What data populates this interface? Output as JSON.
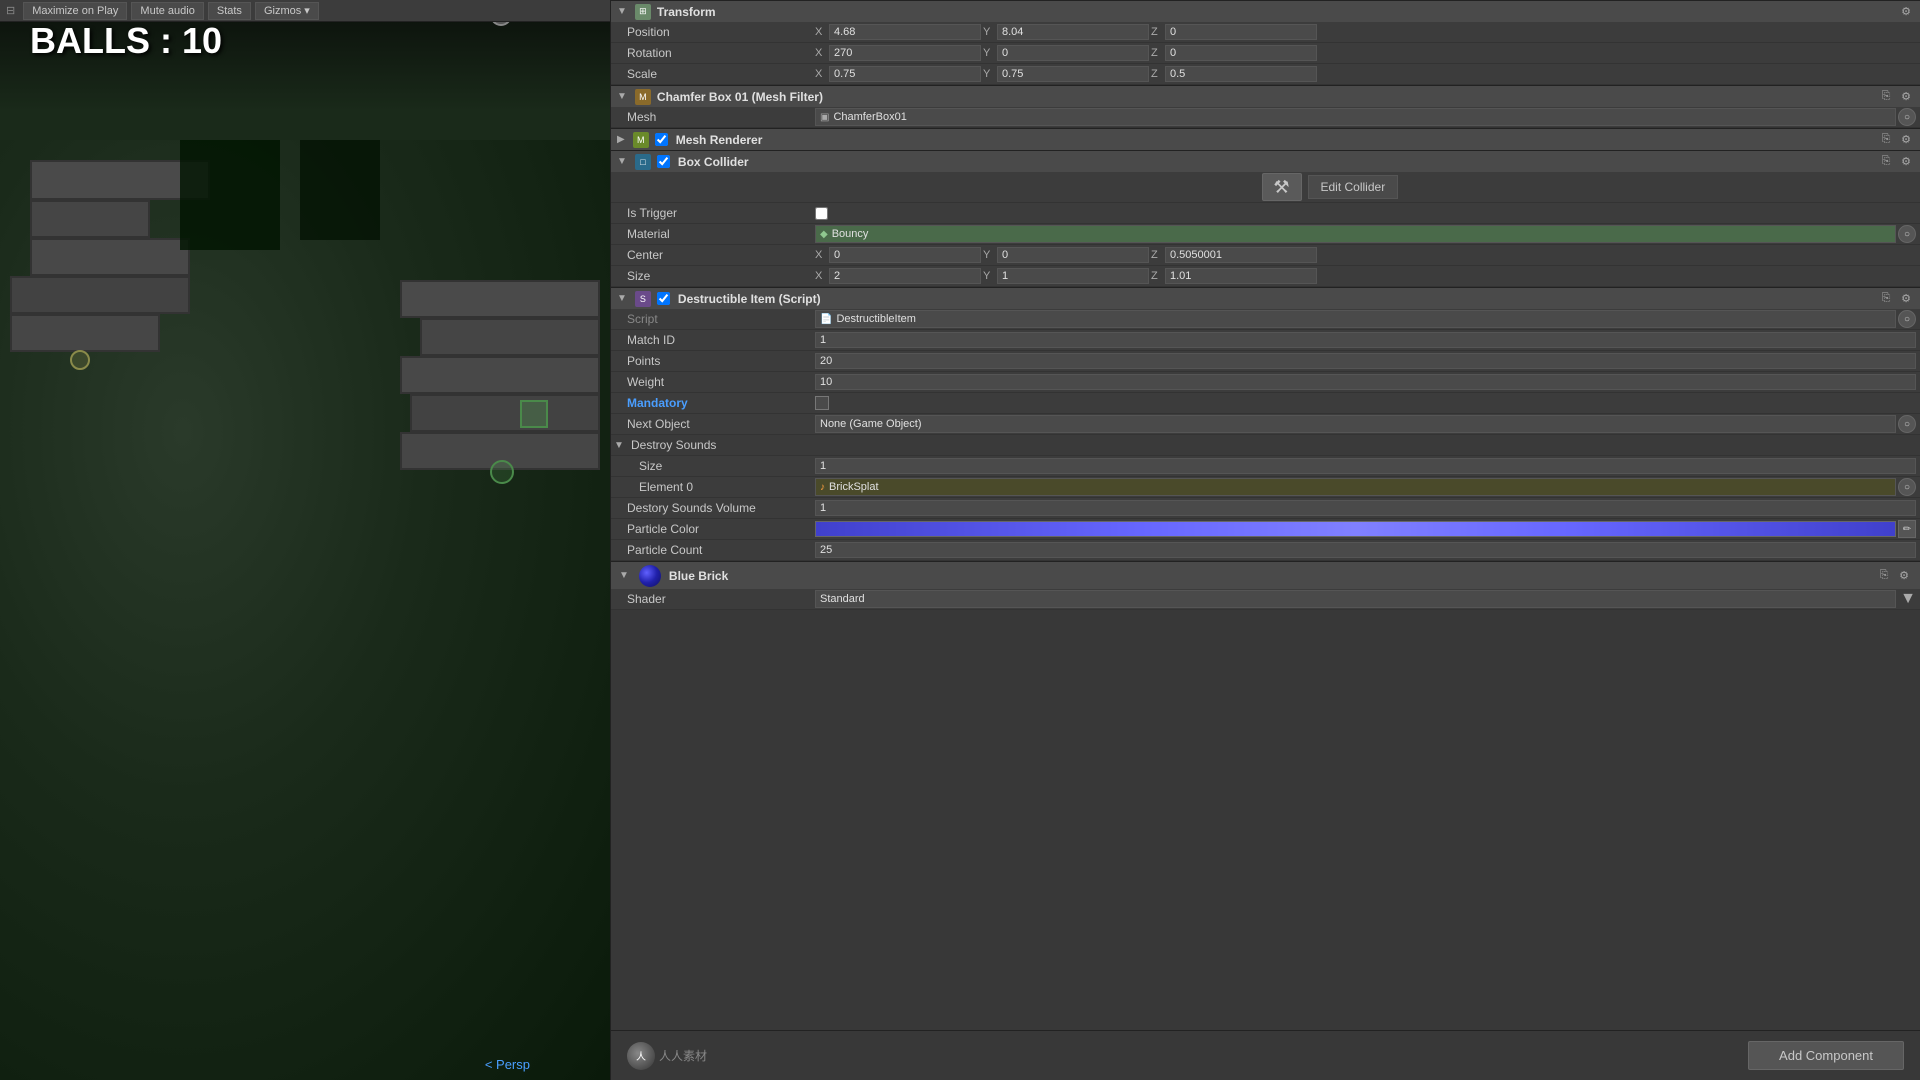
{
  "gameView": {
    "ballsCounter": "BALLS : 10",
    "perspLabel": "< Persp",
    "toolbar": {
      "maximizeLabel": "Maximize on Play",
      "muteLabel": "Mute audio",
      "statsLabel": "Stats",
      "gizmosLabel": "Gizmos ▾"
    }
  },
  "inspector": {
    "transform": {
      "title": "Transform",
      "position": {
        "label": "Position",
        "x": "4.68",
        "y": "8.04",
        "z": "0"
      },
      "rotation": {
        "label": "Rotation",
        "x": "270",
        "y": "0",
        "z": "0"
      },
      "scale": {
        "label": "Scale",
        "x": "0.75",
        "y": "0.75",
        "z": "0.5"
      }
    },
    "meshFilter": {
      "title": "Chamfer Box 01 (Mesh Filter)",
      "meshLabel": "Mesh",
      "meshValue": "ChamferBox01"
    },
    "meshRenderer": {
      "title": "Mesh Renderer"
    },
    "boxCollider": {
      "title": "Box Collider",
      "editBtn": "Edit Collider",
      "isTriggerLabel": "Is Trigger",
      "materialLabel": "Material",
      "materialValue": "Bouncy",
      "centerLabel": "Center",
      "centerX": "0",
      "centerY": "0",
      "centerZ": "0.5050001",
      "sizeLabel": "Size",
      "sizeX": "2",
      "sizeY": "1",
      "sizeZ": "1.01"
    },
    "destructibleItem": {
      "title": "Destructible Item (Script)",
      "scriptLabel": "Script",
      "scriptValue": "DestructibleItem",
      "matchIdLabel": "Match ID",
      "matchIdValue": "1",
      "pointsLabel": "Points",
      "pointsValue": "20",
      "weightLabel": "Weight",
      "weightValue": "10",
      "mandatoryLabel": "Mandatory",
      "nextObjectLabel": "Next Object",
      "nextObjectValue": "None (Game Object)",
      "destroySoundsLabel": "Destroy Sounds",
      "sizeLabel": "Size",
      "sizeValue": "1",
      "element0Label": "Element 0",
      "element0Value": "BrickSplat",
      "destroySoundsVolumeLabel": "Destory Sounds Volume",
      "destroySoundsVolumeValue": "1",
      "particleColorLabel": "Particle Color",
      "particleCountLabel": "Particle Count",
      "particleCountValue": "25"
    },
    "blueBrick": {
      "title": "Blue Brick",
      "shaderLabel": "Shader",
      "shaderValue": "Standard"
    },
    "addComponentBtn": "Add Component"
  }
}
